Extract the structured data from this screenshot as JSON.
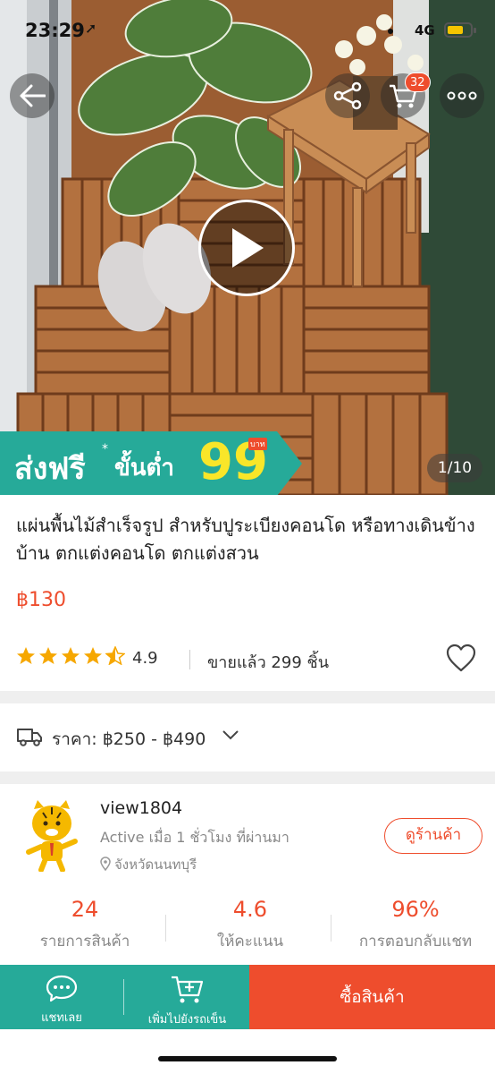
{
  "status_bar": {
    "time": "23:29",
    "location_icon": "location-arrow-icon",
    "network": "4G",
    "battery_level": 0.7
  },
  "header": {
    "cart_count": "32",
    "icons": [
      "back-arrow-icon",
      "share-icon",
      "cart-icon",
      "more-icon"
    ]
  },
  "media": {
    "image_counter": "1/10",
    "play_icon": "play-icon",
    "promo": {
      "main": "ส่งฟรี",
      "star": "*",
      "min_label": "ขั้นต่ำ",
      "amount": "99",
      "unit": "บาท"
    }
  },
  "product": {
    "title": "แผ่นพื้นไม้สำเร็จรูป สำหรับปูระเบียงคอนโด หรือทางเดินข้างบ้าน ตกแต่งคอนโด ตกแต่งสวน",
    "price": "฿130",
    "rating": "4.9",
    "rating_stars": 4.5,
    "sold": "ขายแล้ว 299 ชิ้น"
  },
  "variation": {
    "price_range": "ราคา: ฿250 - ฿490"
  },
  "shop": {
    "name": "view1804",
    "active": "Active เมื่อ 1 ชั่วโมง ที่ผ่านมา",
    "location": "จังหวัดนนทบุรี",
    "view_shop": "ดูร้านค้า",
    "stats": [
      {
        "value": "24",
        "label": "รายการสินค้า"
      },
      {
        "value": "4.6",
        "label": "ให้คะแนน"
      },
      {
        "value": "96%",
        "label": "การตอบกลับแชท"
      }
    ]
  },
  "bottom_bar": {
    "chat": "แชทเลย",
    "add_to_cart": "เพิ่มไปยังรถเข็น",
    "buy": "ซื้อสินค้า"
  },
  "colors": {
    "accent": "#ee4d2d",
    "teal": "#26aa99",
    "promo_yellow": "#f9e629"
  }
}
